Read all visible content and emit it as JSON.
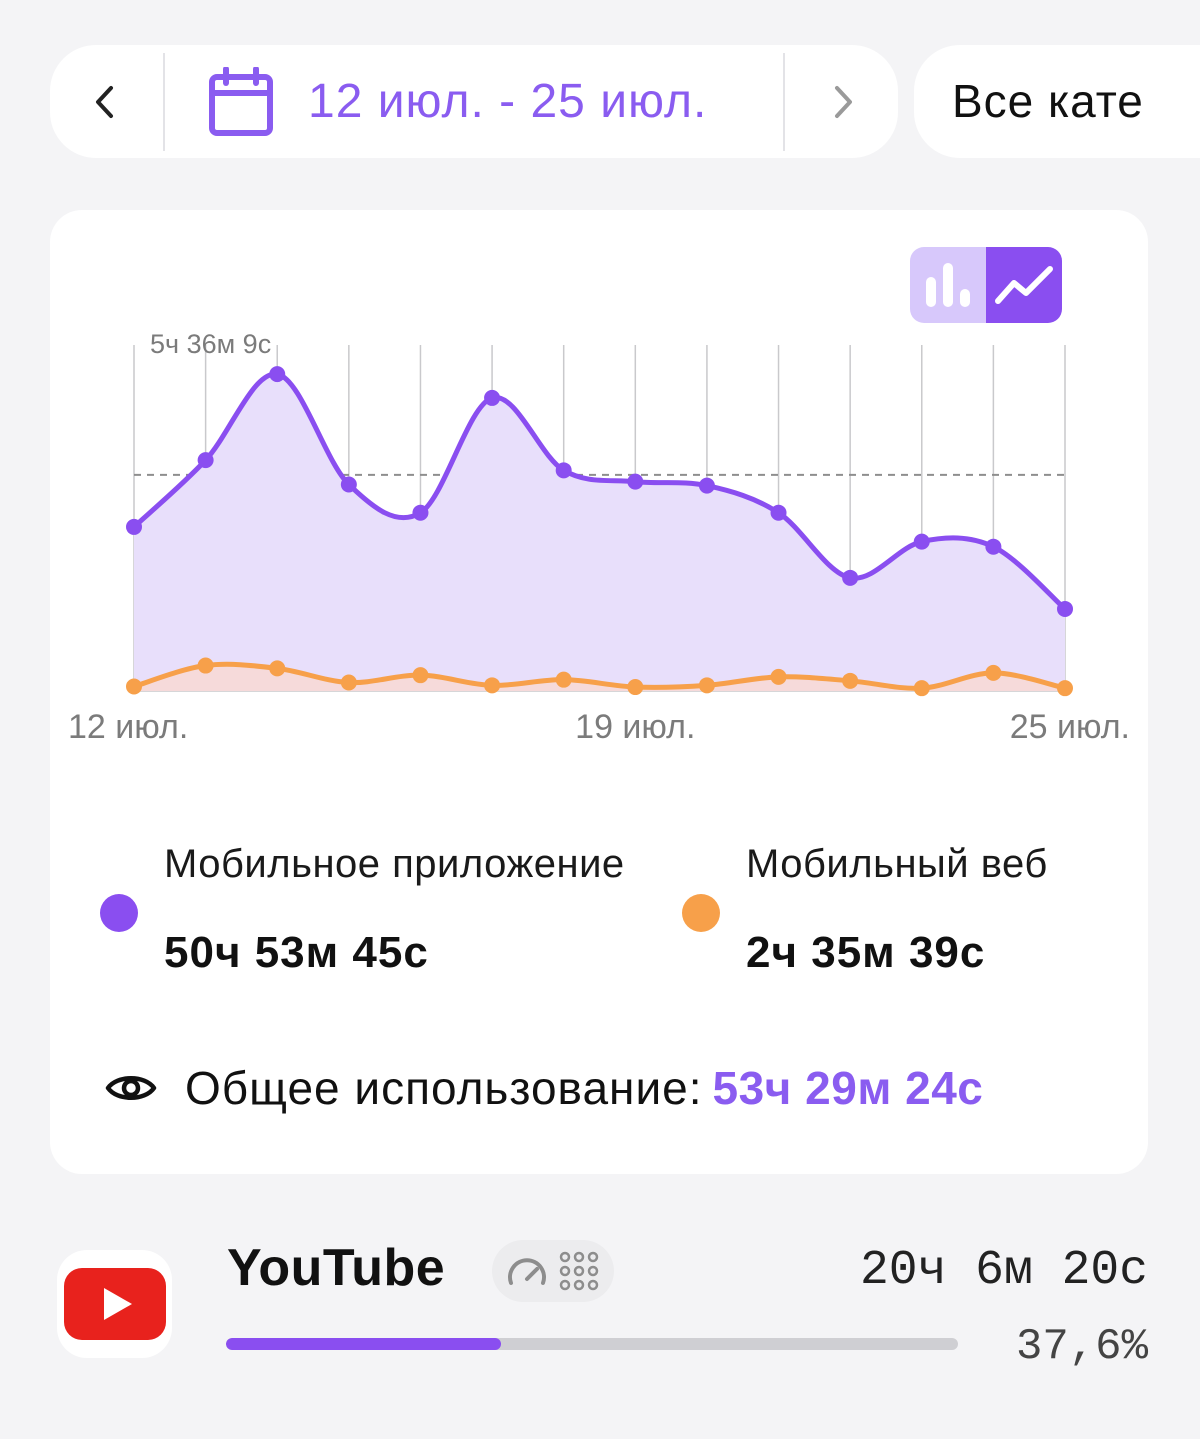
{
  "date_range": {
    "text": "12 июл. - 25 июл.",
    "prev_icon": "chevron-left-icon",
    "next_icon": "chevron-right-icon",
    "calendar_icon": "calendar-icon"
  },
  "category_filter": {
    "label": "Все кате"
  },
  "chart_toggle": {
    "options": [
      "bar-chart-icon",
      "line-chart-icon"
    ],
    "selected": "line"
  },
  "chart_data": {
    "type": "area",
    "x": [
      "12 июл.",
      "13 июл.",
      "14 июл.",
      "15 июл.",
      "16 июл.",
      "17 июл.",
      "18 июл.",
      "19 июл.",
      "20 июл.",
      "21 июл.",
      "22 июл.",
      "23 июл.",
      "24 июл.",
      "25 июл."
    ],
    "x_tick_labels": [
      "12 июл.",
      "19 июл.",
      "25 июл."
    ],
    "peak_label": "5ч 36м 9с",
    "peak_hours": 5.6025,
    "average_line": true,
    "average_hours": 3.82,
    "grid": "vertical",
    "series": [
      {
        "name": "Мобильное приложение",
        "color": "#8a4ef0",
        "values": [
          2.9,
          4.08,
          5.6,
          3.65,
          3.15,
          5.18,
          3.9,
          3.7,
          3.63,
          3.15,
          2.0,
          2.64,
          2.55,
          1.45
        ]
      },
      {
        "name": "Мобильный веб",
        "color": "#f7a04a",
        "values": [
          0.08,
          0.45,
          0.4,
          0.15,
          0.28,
          0.1,
          0.2,
          0.07,
          0.1,
          0.25,
          0.18,
          0.05,
          0.32,
          0.05
        ]
      }
    ]
  },
  "legend": [
    {
      "label": "Мобильное приложение",
      "value": "50ч 53м 45с",
      "color": "#8a4ef0"
    },
    {
      "label": "Мобильный веб",
      "value": "2ч 35м 39с",
      "color": "#f7a04a"
    }
  ],
  "total": {
    "icon": "eye-icon",
    "label": "Общее использование:",
    "value": "53ч 29м 24с"
  },
  "apps": [
    {
      "name": "YouTube",
      "time": "20ч 6м 20с",
      "percent_label": "37,6%",
      "share": 0.376,
      "icon": "youtube-icon",
      "badge_icons": [
        "speedometer-icon",
        "grid-dots-icon"
      ]
    }
  ]
}
